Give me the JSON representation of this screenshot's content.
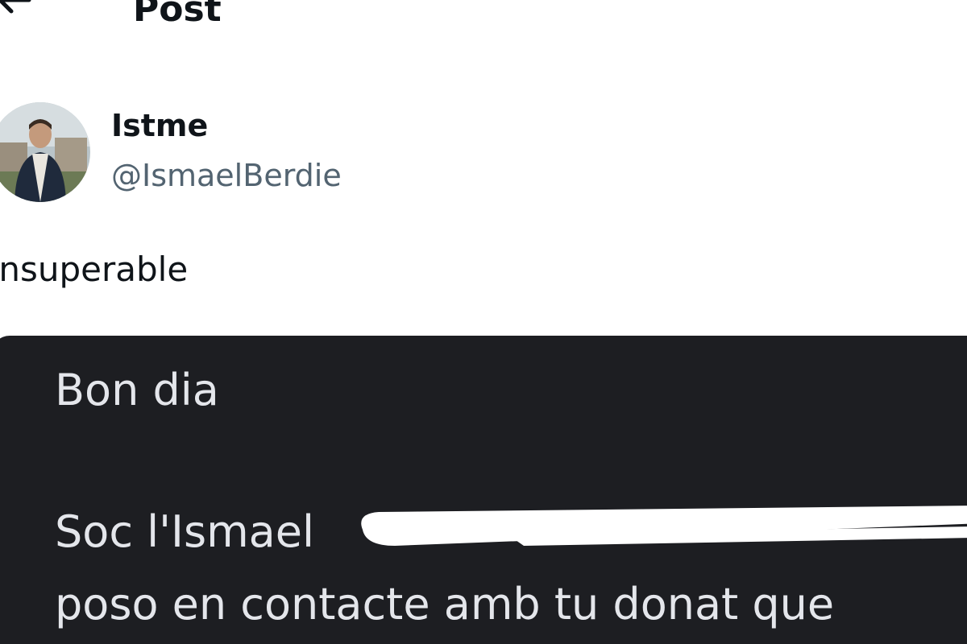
{
  "header": {
    "title": "Post",
    "back_icon": "arrow-left-icon"
  },
  "post": {
    "author": {
      "display_name": "Istme",
      "handle": "@IsmaelBerdie"
    },
    "text": "Insuperable",
    "image": {
      "lines": [
        "Bon dia",
        "Soc l'Ismael",
        "poso en contacte amb tu donat que"
      ]
    }
  },
  "colors": {
    "text_primary": "#0f1419",
    "text_secondary": "#536471",
    "message_bg": "#1d1e22",
    "message_text": "#e4e6eb"
  }
}
